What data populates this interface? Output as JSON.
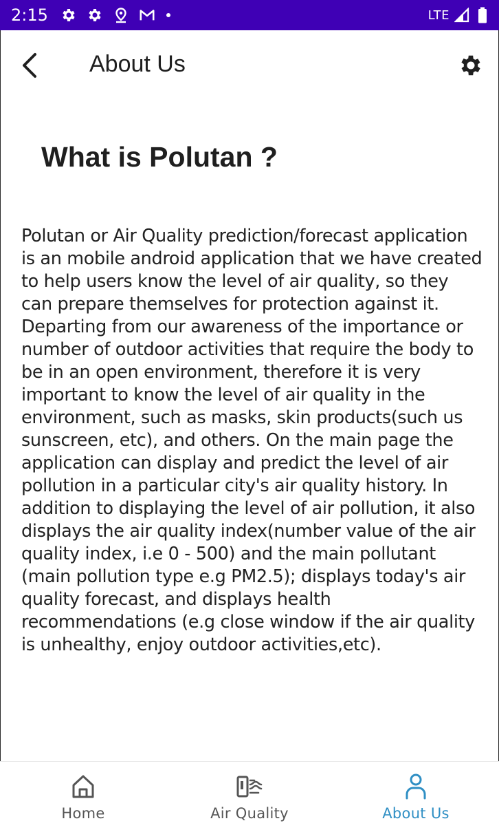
{
  "status_bar": {
    "time": "2:15",
    "icons": [
      "settings-icon",
      "settings-icon",
      "location-icon",
      "gmail-icon",
      "dot-icon"
    ],
    "network": "LTE",
    "right_icons": [
      "signal-icon",
      "battery-icon"
    ],
    "background_color": "#3f00b5"
  },
  "app_bar": {
    "back_icon": "back-arrow-icon",
    "title": "About Us",
    "settings_icon": "gear-icon"
  },
  "content": {
    "heading": "What is Polutan ?",
    "paragraph": "Polutan or Air Quality prediction/forecast application is an mobile android application that we have created to help users know the level of air quality, so they can prepare themselves for protection against it. Departing from our awareness of the importance or number of outdoor activities that require the body to be in an open environment, therefore it is very important to know the level of air quality in the environment, such as masks, skin products(such us sunscreen, etc), and others. On the main page the application can display and predict the level of air pollution in a particular city's air quality history. In addition to displaying the level of air pollution, it also displays the air quality index(number value of the air quality index, i.e 0 - 500) and the main pollutant (main pollution type e.g PM2.5); displays today's air quality forecast, and displays health recommendations (e.g close window if the air quality is unhealthy, enjoy outdoor activities,etc)."
  },
  "bottom_nav": {
    "items": [
      {
        "label": "Home",
        "icon": "home-icon",
        "active": false
      },
      {
        "label": "Air Quality",
        "icon": "air-quality-icon",
        "active": false
      },
      {
        "label": "About Us",
        "icon": "person-icon",
        "active": true
      }
    ],
    "active_color": "#2f8fc4",
    "inactive_color": "#555555"
  }
}
